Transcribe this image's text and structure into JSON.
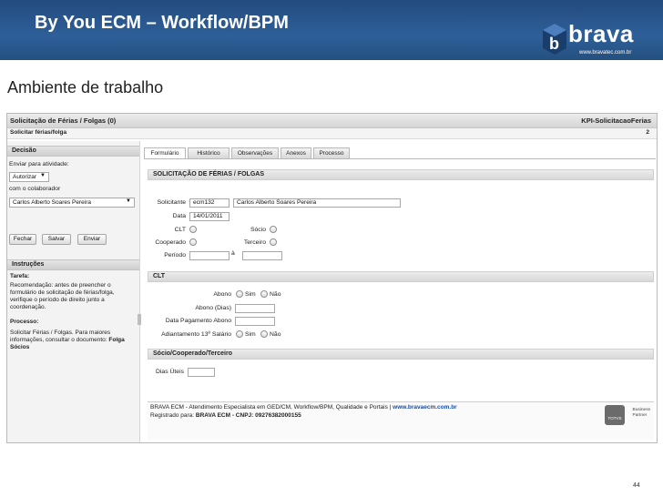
{
  "slide": {
    "title": "By You ECM – Workflow/BPM",
    "subtitle": "Ambiente de trabalho",
    "logo_word": "brava",
    "logo_url": "www.bravatec.com.br",
    "page_number": "44"
  },
  "app": {
    "title": "Solicitação de Férias / Folgas (0)",
    "process_id": "KPI-SolicitacaoFerias",
    "subtitle": "Solicitar férias/folga",
    "count": "2"
  },
  "decision": {
    "header": "Decisão",
    "send_label": "Enviar para atividade:",
    "activity_value": "Autorizar",
    "collab_label": "com o colaborador",
    "collab_value": "Carlos Alberto Soares Pereira",
    "buttons": {
      "close": "Fechar",
      "save": "Salvar",
      "send": "Enviar"
    }
  },
  "instructions": {
    "header": "Instruções",
    "task_label": "Tarefa:",
    "task_text": "Recomendação: antes de preencher o formulário de solicitação de férias/folga, verifique o período de direito junto a coordenação.",
    "process_label": "Processo:",
    "process_text": "Solicitar Férias / Folgas. Para maiores informações, consultar o documento:",
    "doc_link": "Folga Sócios"
  },
  "tabs": [
    "Formulário",
    "Histórico",
    "Observações",
    "Anexos",
    "Processo"
  ],
  "form": {
    "section_title": "SOLICITAÇÃO DE FÉRIAS / FOLGAS",
    "solicitante_label": "Solicitante",
    "solicitante_id": "ecm132",
    "solicitante_name": "Carlos Alberto Soares Pereira",
    "data_label": "Data",
    "data_value": "14/01/2011",
    "clt_label": "CLT",
    "socio_label": "Sócio",
    "cooperado_label": "Cooperado",
    "terceiro_label": "Terceiro",
    "periodo_label": "Período",
    "periodo_sep": "à"
  },
  "clt": {
    "section_title": "CLT",
    "abono_label": "Abono",
    "sim": "Sim",
    "nao": "Não",
    "abono_dias_label": "Abono (Dias)",
    "data_pagamento_label": "Data Pagamento Abono",
    "adiantamento_label": "Adiantamento 13º Salário"
  },
  "socio_section": {
    "section_title": "Sócio/Cooperado/Terceiro",
    "dias_uteis_label": "Dias Úteis"
  },
  "footer": {
    "line1_text": "BRAVA ECM - Atendimento Especialista em GED/CM, Workflow/BPM, Qualidade e Portais |",
    "line1_link": "www.bravaecm.com.br",
    "line2_prefix": "Registrado para:",
    "line2_company": "BRAVA ECM - CNPJ: 09276382000155",
    "totvs": "TOTVS",
    "business_partner_1": "Business",
    "business_partner_2": "Partner"
  },
  "colors": {
    "header_blue": "#2e5f99",
    "link_blue": "#1d4b9b"
  }
}
